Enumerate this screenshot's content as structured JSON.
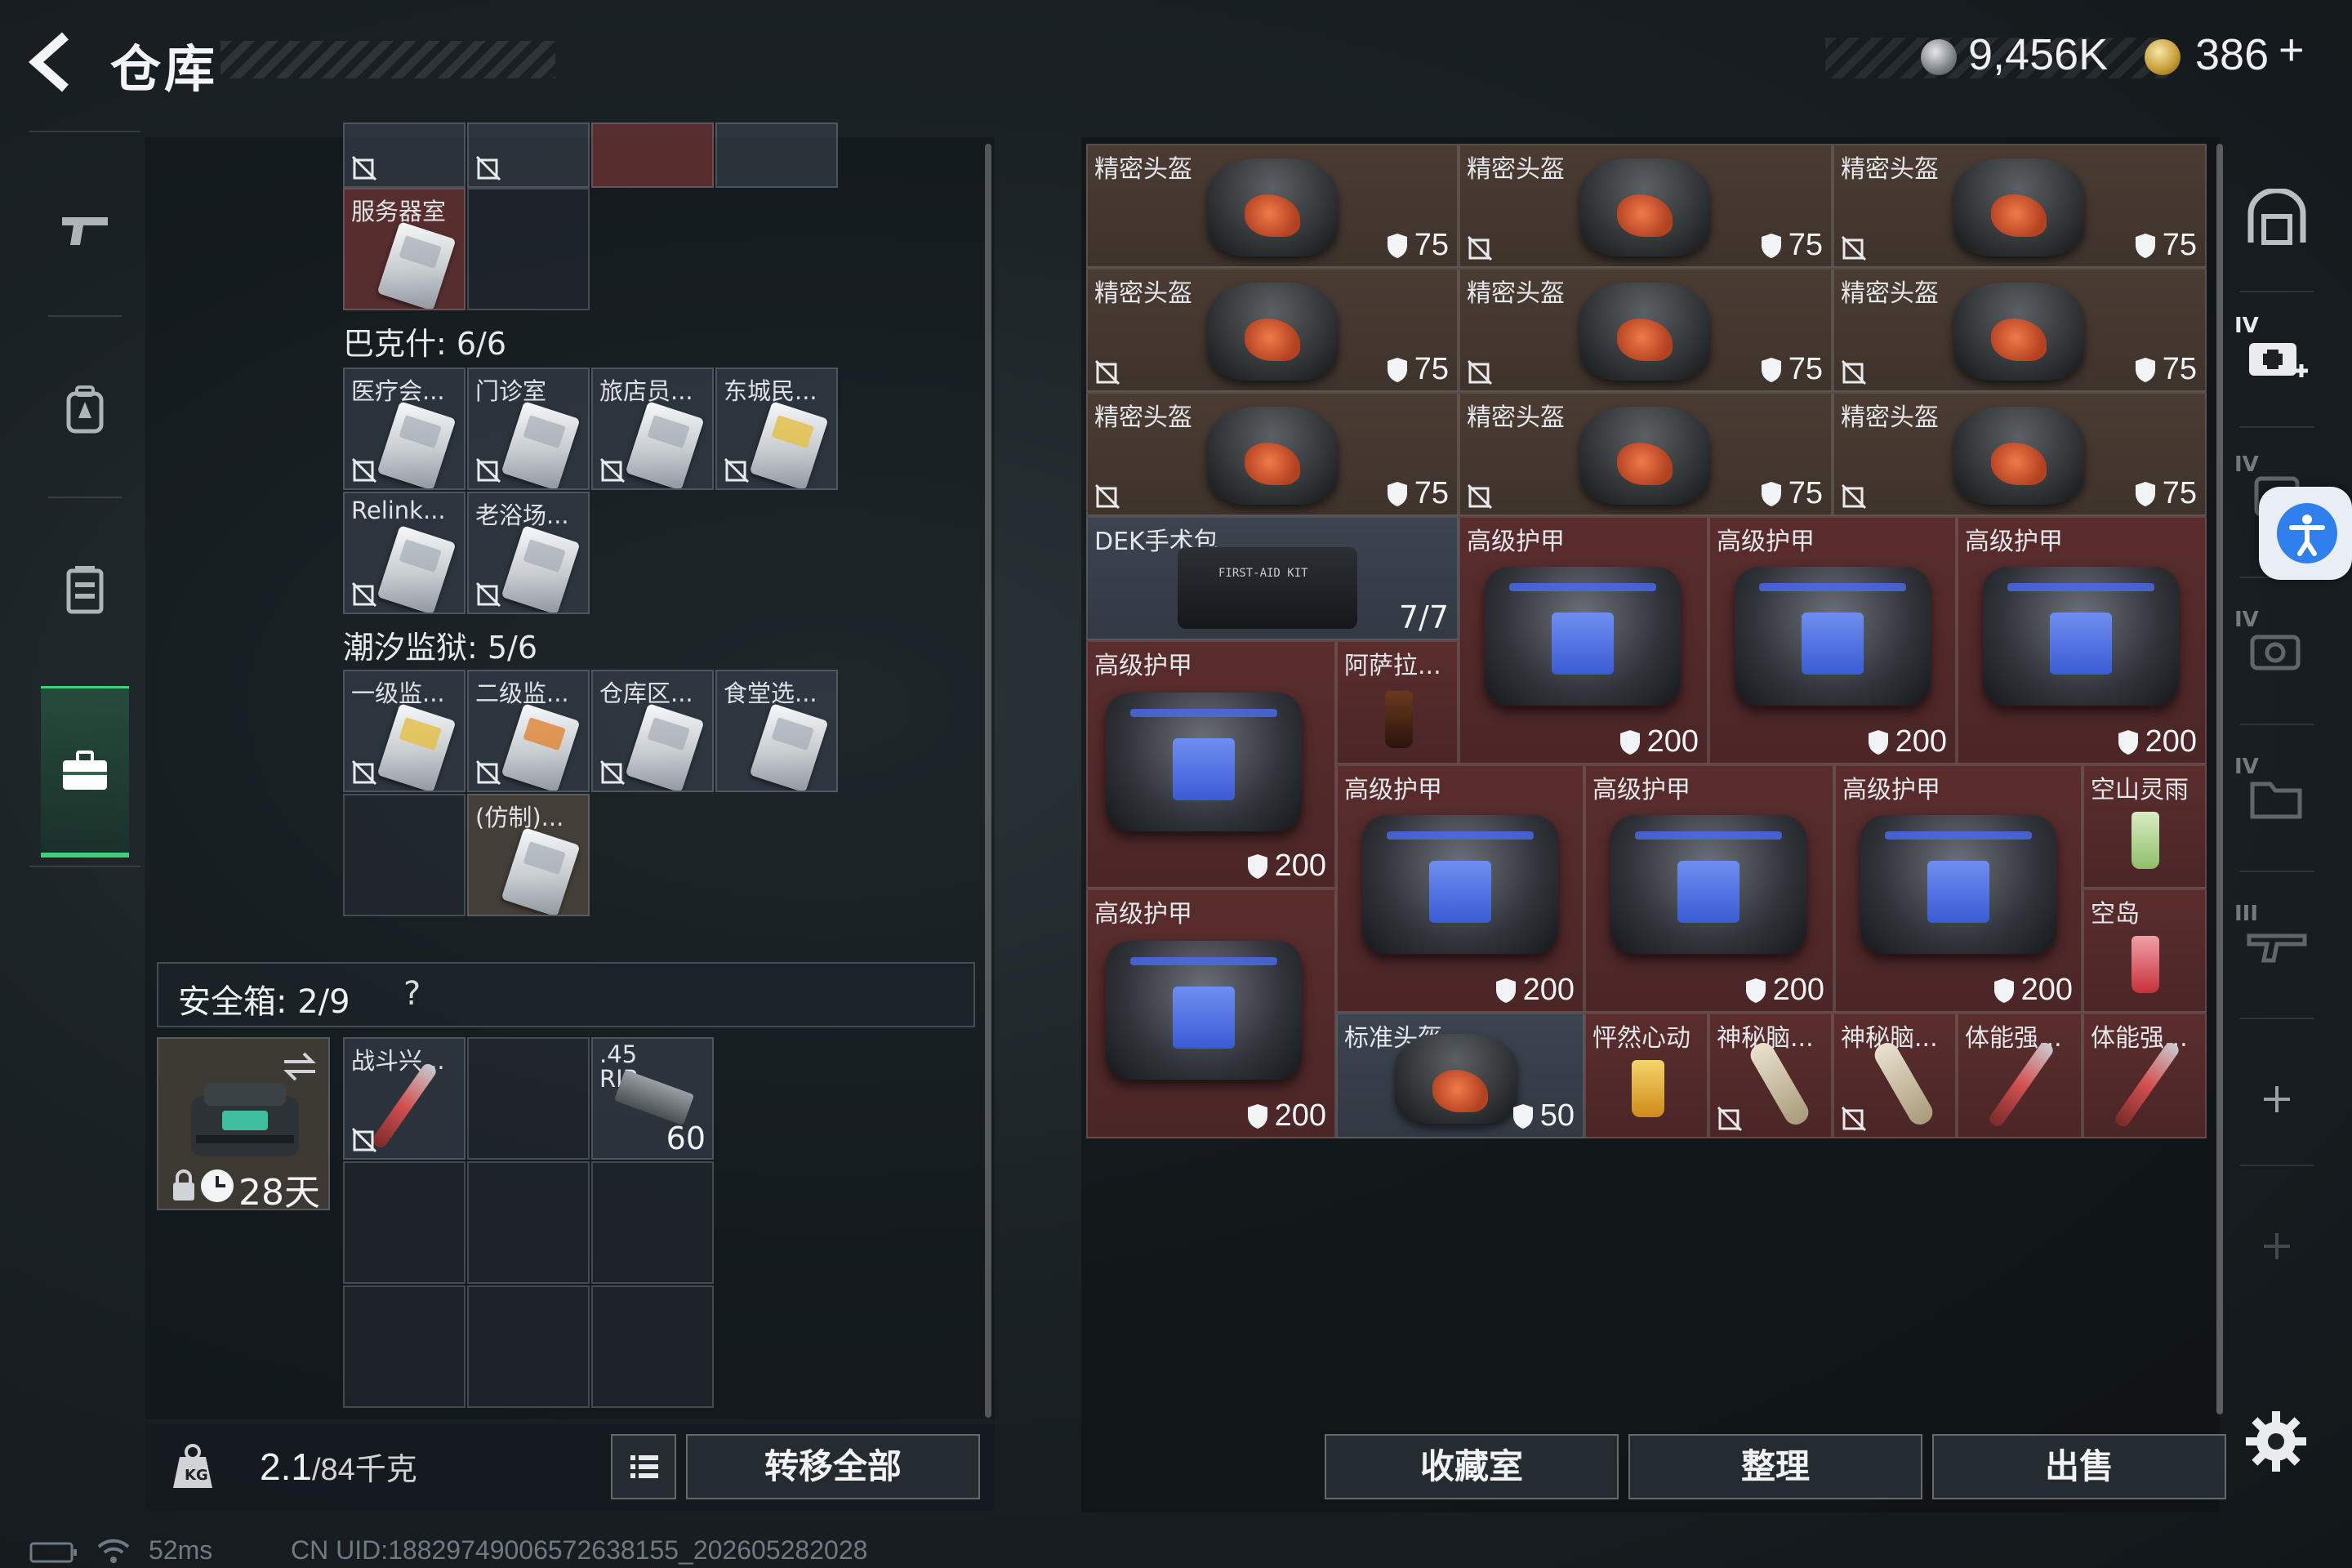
{
  "header": {
    "title": "仓库",
    "currency_silver": "9,456K",
    "currency_gold": "386",
    "add_symbol": "+"
  },
  "left_nav": [
    "gun-icon",
    "backpack-icon",
    "vest-icon",
    "toolbox-icon"
  ],
  "left_panel": {
    "top_row_labels": [
      "",
      "",
      "",
      ""
    ],
    "server_room_label": "服务器室",
    "bakesh_section": "巴克什: 6/6",
    "bakesh_keys": [
      "医疗会...",
      "门诊室",
      "旅店员...",
      "东城民...",
      "Relink...",
      "老浴场..."
    ],
    "prison_section": "潮汐监狱: 5/6",
    "prison_keys": [
      "一级监...",
      "二级监...",
      "仓库区...",
      "食堂选...",
      "(仿制)..."
    ],
    "safebox_label": "安全箱: 2/9",
    "safebox_help": "?",
    "safe_case_days": "28天",
    "safe_items": [
      {
        "label": "战斗兴...",
        "value": ""
      },
      {
        "label": ".45 RIP",
        "value": "60"
      }
    ],
    "weight_current": "2.1",
    "weight_max": "/84千克",
    "transfer_all": "转移全部"
  },
  "right_panel": {
    "helmets": [
      {
        "label": "精密头盔",
        "value": "75"
      },
      {
        "label": "精密头盔",
        "value": "75"
      },
      {
        "label": "精密头盔",
        "value": "75"
      },
      {
        "label": "精密头盔",
        "value": "75"
      },
      {
        "label": "精密头盔",
        "value": "75"
      },
      {
        "label": "精密头盔",
        "value": "75"
      },
      {
        "label": "精密头盔",
        "value": "75"
      },
      {
        "label": "精密头盔",
        "value": "75"
      },
      {
        "label": "精密头盔",
        "value": "75"
      }
    ],
    "dek_bag": {
      "label": "DEK手术包",
      "value": "7/7",
      "text_on_item": "FIRST-AID KIT"
    },
    "armors": [
      {
        "label": "高级护甲",
        "value": "200"
      },
      {
        "label": "高级护甲",
        "value": "200"
      },
      {
        "label": "高级护甲",
        "value": "200"
      },
      {
        "label": "高级护甲",
        "value": "200"
      },
      {
        "label": "高级护甲",
        "value": "200"
      },
      {
        "label": "高级护甲",
        "value": "200"
      },
      {
        "label": "高级护甲",
        "value": "200"
      },
      {
        "label": "高级护甲",
        "value": "200"
      }
    ],
    "small_items": {
      "asala": "阿萨拉...",
      "kongshan": "空山灵雨",
      "kongdao": "空岛",
      "std_helmet": "标准头盔",
      "std_helmet_value": "50",
      "pengran": "怦然心动",
      "mystery1": "神秘脑...",
      "mystery2": "神秘脑...",
      "stim1": "体能强...",
      "stim2": "体能强..."
    },
    "buttons": [
      "收藏室",
      "整理",
      "出售"
    ]
  },
  "right_rail": {
    "icons": [
      "safe-icon",
      "medkit-upgrade-icon",
      "armor-upgrade-icon",
      "camera-upgrade-icon",
      "folder-upgrade-icon",
      "weapon-upgrade-icon",
      "add-icon",
      "add-icon-dim"
    ],
    "tier_labels": [
      "IV",
      "IV",
      "IV",
      "IV",
      "III"
    ]
  },
  "status_bar": {
    "ping": "52ms",
    "uid": "CN UID:18829749006572638155_202605282028"
  },
  "colors": {
    "accent_green": "#3ed07b",
    "armor_blue": "#4a6cf0",
    "helmet_orange": "#f07a4a",
    "access_blue": "#2f80ed"
  }
}
